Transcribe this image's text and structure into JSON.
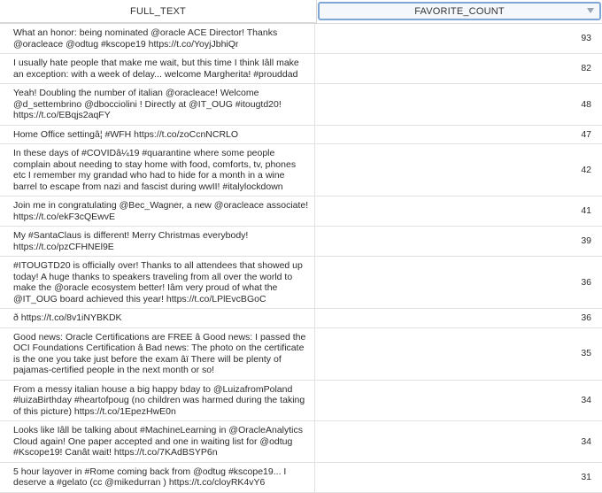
{
  "header": {
    "col1": "FULL_TEXT",
    "col2": "FAVORITE_COUNT"
  },
  "rows": [
    {
      "text": "What an honor: being nominated @oracle ACE Director! Thanks @oracleace @odtug #kscope19 https://t.co/YoyjJbhiQr",
      "count": "93"
    },
    {
      "text": "I usually hate people that make me wait, but this time I think Iâll make an exception: with a week of delay... welcome Margherita! #prouddad",
      "count": "82"
    },
    {
      "text": "Yeah! Doubling the number of italian @oracleace! Welcome @d_settembrino @dbocciolini ! Directly at @IT_OUG #itougtd20! https://t.co/EBqjs2aqFY",
      "count": "48"
    },
    {
      "text": "Home Office settingâ¦ #WFH https://t.co/zoCcnNCRLO",
      "count": "47"
    },
    {
      "text": "In these days of #COVIDâ¼19 #quarantine where some people complain about needing to stay home with food, comforts, tv, phones etc I remember my grandad who had to hide for a month in a wine barrel to escape from nazi and fascist during wwII! #italylockdown",
      "count": "42"
    },
    {
      "text": "Join me in congratulating @Bec_Wagner, a new @oracleace associate! https://t.co/ekF3cQEwvE",
      "count": "41"
    },
    {
      "text": "My #SantaClaus is different! Merry Christmas everybody! https://t.co/pzCFHNEl9E",
      "count": "39"
    },
    {
      "text": "#ITOUGTD20 is officially over! Thanks to all attendees that showed up today! A huge thanks to speakers traveling from all over the world to make the @oracle ecosystem better! Iâm very proud of what the @IT_OUG board achieved this year! https://t.co/LPlEvcBGoC",
      "count": "36"
    },
    {
      "text": "ð https://t.co/8v1iNYBKDK",
      "count": "36"
    },
    {
      "text": "Good news: Oracle Certifications are FREE â Good news: I passed the OCI Foundations Certification â Bad news: The photo on the certificate is the one you take just before the exam âï There will be plenty of pajamas-certified people in the next month or so!",
      "count": "35"
    },
    {
      "text": "From a messy italian house a big happy bday to @LuizafromPoland #luizaBirthday #heartofpoug (no children was harmed during the taking of this picture) https://t.co/1EpezHwE0n",
      "count": "34"
    },
    {
      "text": "Looks like Iâll be talking about #MachineLearning in @OracleAnalytics Cloud again! One paper accepted and one in waiting list for @odtug #Kscope19! Canât wait! https://t.co/7KAdBSYP6n",
      "count": "34"
    },
    {
      "text": "5 hour layover in #Rome coming back from @odtug #kscope19... I deserve a #gelato (cc @mikedurran ) https://t.co/cloyRK4vY6",
      "count": "31"
    }
  ]
}
